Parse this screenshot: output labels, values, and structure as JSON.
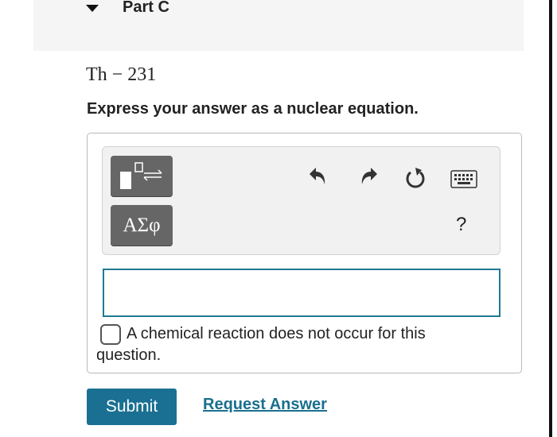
{
  "part": {
    "title": "Part C"
  },
  "problem": {
    "isotope": "Th − 231",
    "instruction": "Express your answer as a nuclear equation."
  },
  "toolbar": {
    "template_icon": "template-reaction-icon",
    "greek_label": "ΑΣφ",
    "undo_icon": "undo-icon",
    "redo_icon": "redo-icon",
    "reset_icon": "reset-icon",
    "keyboard_icon": "keyboard-icon",
    "help_label": "?"
  },
  "answer_input": {
    "value": ""
  },
  "no_reaction": {
    "line1": "A chemical reaction does not occur for this",
    "line2": "question.",
    "checked": false
  },
  "actions": {
    "submit_label": "Submit",
    "request_label": "Request Answer"
  },
  "colors": {
    "accent": "#1a7092",
    "link": "#1a6f8e",
    "input_border": "#1f7a93",
    "tool_button": "#666666"
  }
}
